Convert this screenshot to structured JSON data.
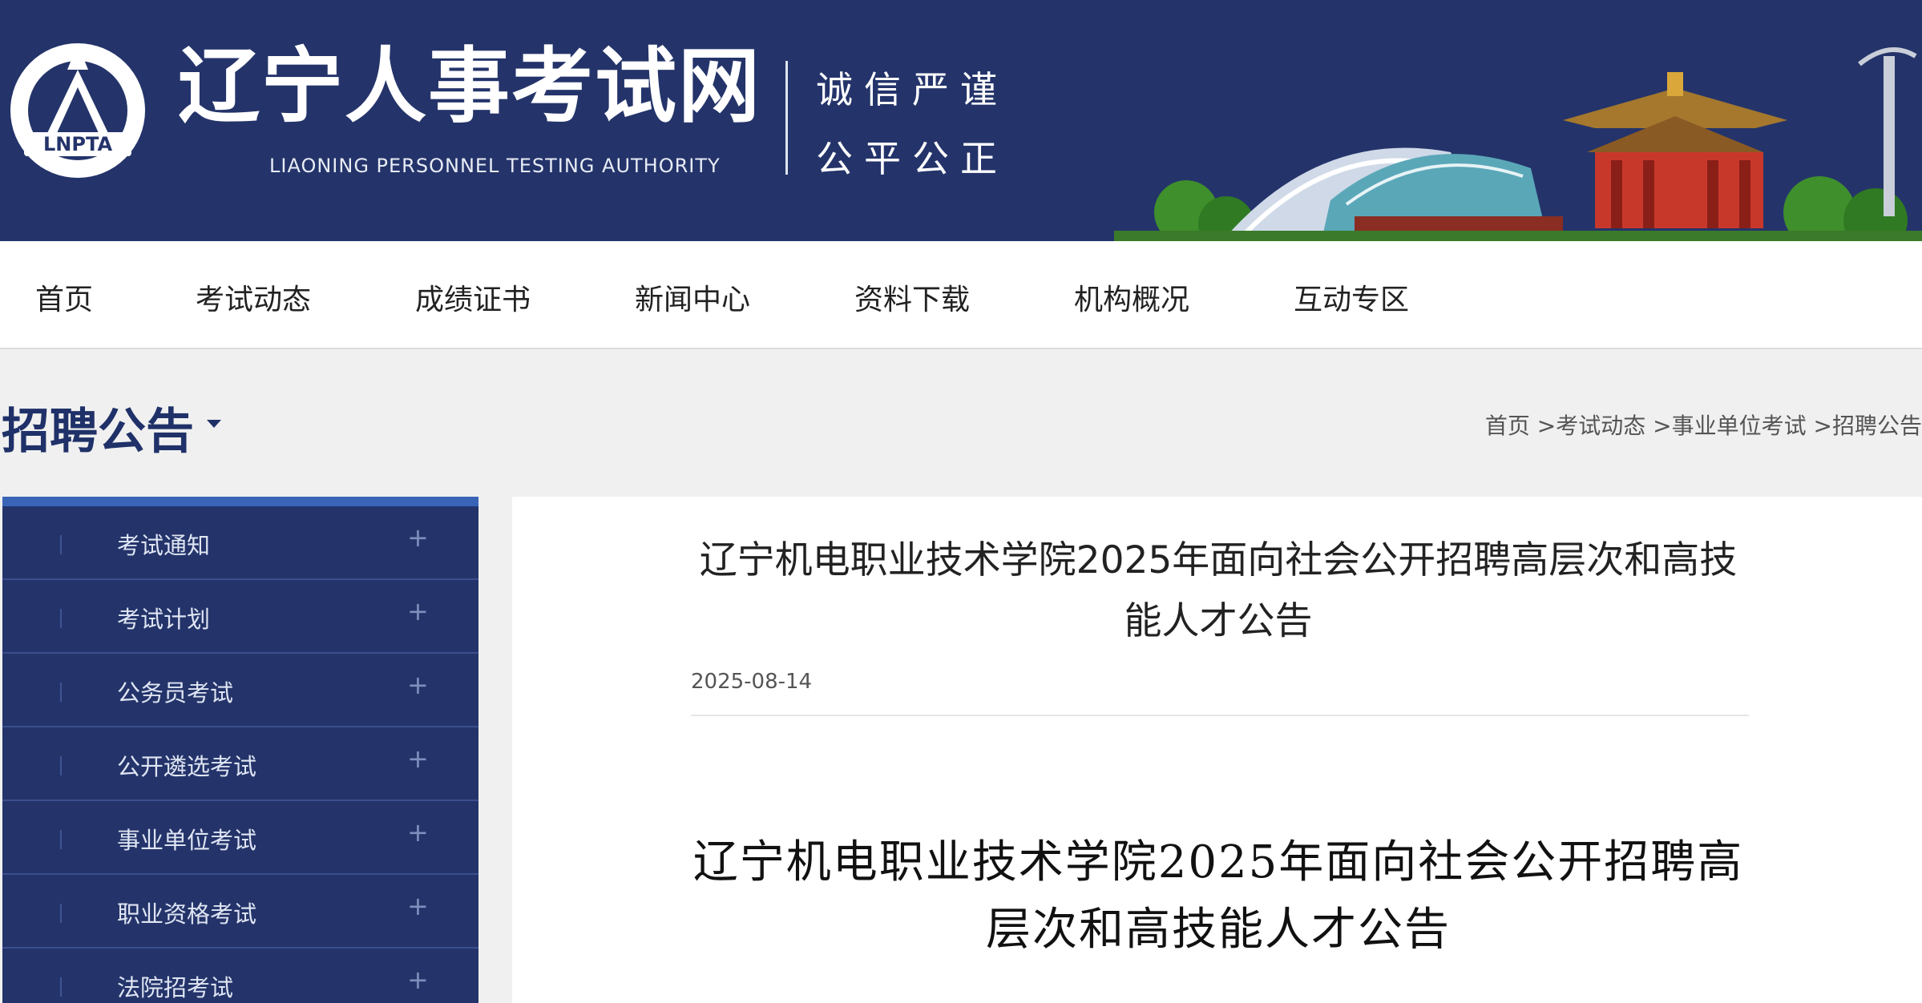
{
  "header": {
    "logo_text": "LNPTA",
    "site_title": "辽宁人事考试网",
    "site_subtitle": "LIAONING PERSONNEL TESTING AUTHORITY",
    "motto_line1": "诚信严谨",
    "motto_line2": "公平公正",
    "colors": {
      "banner": "#24346a",
      "accent": "#3a64b8"
    }
  },
  "nav": {
    "items": [
      {
        "label": "首页"
      },
      {
        "label": "考试动态"
      },
      {
        "label": "成绩证书"
      },
      {
        "label": "新闻中心"
      },
      {
        "label": "资料下载"
      },
      {
        "label": "机构概况"
      },
      {
        "label": "互动专区"
      }
    ]
  },
  "page": {
    "heading": "招聘公告",
    "breadcrumb": [
      {
        "label": "首页"
      },
      {
        "label": " >考试动态"
      },
      {
        "label": " >事业单位考试"
      },
      {
        "label": " >招聘公告"
      }
    ]
  },
  "sidebar": {
    "items": [
      {
        "label": "考试通知",
        "icon": "plus-icon"
      },
      {
        "label": "考试计划",
        "icon": "plus-icon"
      },
      {
        "label": "公务员考试",
        "icon": "plus-icon"
      },
      {
        "label": "公开遴选考试",
        "icon": "plus-icon"
      },
      {
        "label": "事业单位考试",
        "icon": "plus-icon"
      },
      {
        "label": "职业资格考试",
        "icon": "plus-icon"
      },
      {
        "label": "法院招考试",
        "icon": "plus-icon"
      }
    ]
  },
  "article": {
    "title": "辽宁机电职业技术学院2025年面向社会公开招聘高层次和高技能人才公告",
    "date": "2025-08-14",
    "doc_title": "辽宁机电职业技术学院2025年面向社会公开招聘高层次和高技能人才公告"
  }
}
